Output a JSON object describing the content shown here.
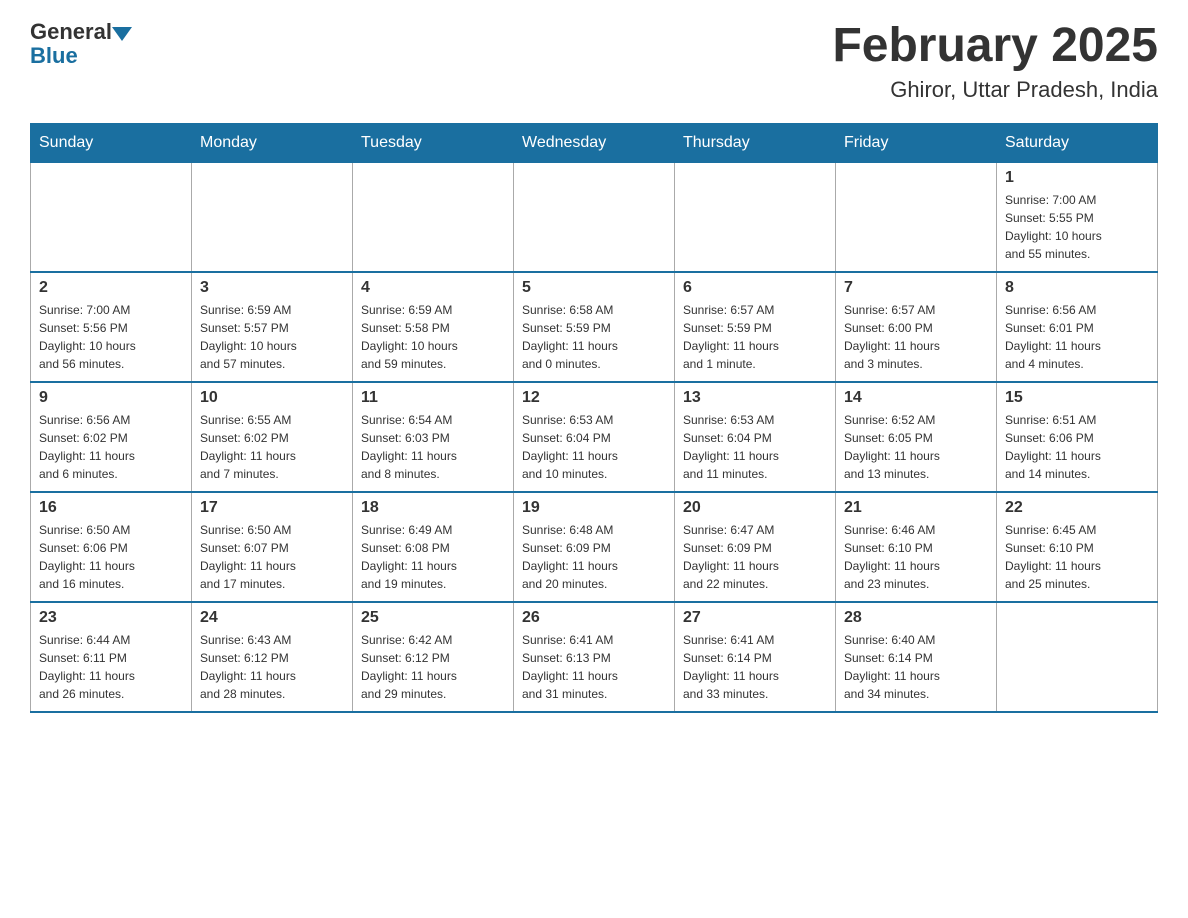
{
  "header": {
    "logo_general": "General",
    "logo_blue": "Blue",
    "month_title": "February 2025",
    "location": "Ghiror, Uttar Pradesh, India"
  },
  "days_of_week": [
    "Sunday",
    "Monday",
    "Tuesday",
    "Wednesday",
    "Thursday",
    "Friday",
    "Saturday"
  ],
  "weeks": [
    {
      "days": [
        {
          "date": "",
          "info": ""
        },
        {
          "date": "",
          "info": ""
        },
        {
          "date": "",
          "info": ""
        },
        {
          "date": "",
          "info": ""
        },
        {
          "date": "",
          "info": ""
        },
        {
          "date": "",
          "info": ""
        },
        {
          "date": "1",
          "info": "Sunrise: 7:00 AM\nSunset: 5:55 PM\nDaylight: 10 hours\nand 55 minutes."
        }
      ]
    },
    {
      "days": [
        {
          "date": "2",
          "info": "Sunrise: 7:00 AM\nSunset: 5:56 PM\nDaylight: 10 hours\nand 56 minutes."
        },
        {
          "date": "3",
          "info": "Sunrise: 6:59 AM\nSunset: 5:57 PM\nDaylight: 10 hours\nand 57 minutes."
        },
        {
          "date": "4",
          "info": "Sunrise: 6:59 AM\nSunset: 5:58 PM\nDaylight: 10 hours\nand 59 minutes."
        },
        {
          "date": "5",
          "info": "Sunrise: 6:58 AM\nSunset: 5:59 PM\nDaylight: 11 hours\nand 0 minutes."
        },
        {
          "date": "6",
          "info": "Sunrise: 6:57 AM\nSunset: 5:59 PM\nDaylight: 11 hours\nand 1 minute."
        },
        {
          "date": "7",
          "info": "Sunrise: 6:57 AM\nSunset: 6:00 PM\nDaylight: 11 hours\nand 3 minutes."
        },
        {
          "date": "8",
          "info": "Sunrise: 6:56 AM\nSunset: 6:01 PM\nDaylight: 11 hours\nand 4 minutes."
        }
      ]
    },
    {
      "days": [
        {
          "date": "9",
          "info": "Sunrise: 6:56 AM\nSunset: 6:02 PM\nDaylight: 11 hours\nand 6 minutes."
        },
        {
          "date": "10",
          "info": "Sunrise: 6:55 AM\nSunset: 6:02 PM\nDaylight: 11 hours\nand 7 minutes."
        },
        {
          "date": "11",
          "info": "Sunrise: 6:54 AM\nSunset: 6:03 PM\nDaylight: 11 hours\nand 8 minutes."
        },
        {
          "date": "12",
          "info": "Sunrise: 6:53 AM\nSunset: 6:04 PM\nDaylight: 11 hours\nand 10 minutes."
        },
        {
          "date": "13",
          "info": "Sunrise: 6:53 AM\nSunset: 6:04 PM\nDaylight: 11 hours\nand 11 minutes."
        },
        {
          "date": "14",
          "info": "Sunrise: 6:52 AM\nSunset: 6:05 PM\nDaylight: 11 hours\nand 13 minutes."
        },
        {
          "date": "15",
          "info": "Sunrise: 6:51 AM\nSunset: 6:06 PM\nDaylight: 11 hours\nand 14 minutes."
        }
      ]
    },
    {
      "days": [
        {
          "date": "16",
          "info": "Sunrise: 6:50 AM\nSunset: 6:06 PM\nDaylight: 11 hours\nand 16 minutes."
        },
        {
          "date": "17",
          "info": "Sunrise: 6:50 AM\nSunset: 6:07 PM\nDaylight: 11 hours\nand 17 minutes."
        },
        {
          "date": "18",
          "info": "Sunrise: 6:49 AM\nSunset: 6:08 PM\nDaylight: 11 hours\nand 19 minutes."
        },
        {
          "date": "19",
          "info": "Sunrise: 6:48 AM\nSunset: 6:09 PM\nDaylight: 11 hours\nand 20 minutes."
        },
        {
          "date": "20",
          "info": "Sunrise: 6:47 AM\nSunset: 6:09 PM\nDaylight: 11 hours\nand 22 minutes."
        },
        {
          "date": "21",
          "info": "Sunrise: 6:46 AM\nSunset: 6:10 PM\nDaylight: 11 hours\nand 23 minutes."
        },
        {
          "date": "22",
          "info": "Sunrise: 6:45 AM\nSunset: 6:10 PM\nDaylight: 11 hours\nand 25 minutes."
        }
      ]
    },
    {
      "days": [
        {
          "date": "23",
          "info": "Sunrise: 6:44 AM\nSunset: 6:11 PM\nDaylight: 11 hours\nand 26 minutes."
        },
        {
          "date": "24",
          "info": "Sunrise: 6:43 AM\nSunset: 6:12 PM\nDaylight: 11 hours\nand 28 minutes."
        },
        {
          "date": "25",
          "info": "Sunrise: 6:42 AM\nSunset: 6:12 PM\nDaylight: 11 hours\nand 29 minutes."
        },
        {
          "date": "26",
          "info": "Sunrise: 6:41 AM\nSunset: 6:13 PM\nDaylight: 11 hours\nand 31 minutes."
        },
        {
          "date": "27",
          "info": "Sunrise: 6:41 AM\nSunset: 6:14 PM\nDaylight: 11 hours\nand 33 minutes."
        },
        {
          "date": "28",
          "info": "Sunrise: 6:40 AM\nSunset: 6:14 PM\nDaylight: 11 hours\nand 34 minutes."
        },
        {
          "date": "",
          "info": ""
        }
      ]
    }
  ]
}
